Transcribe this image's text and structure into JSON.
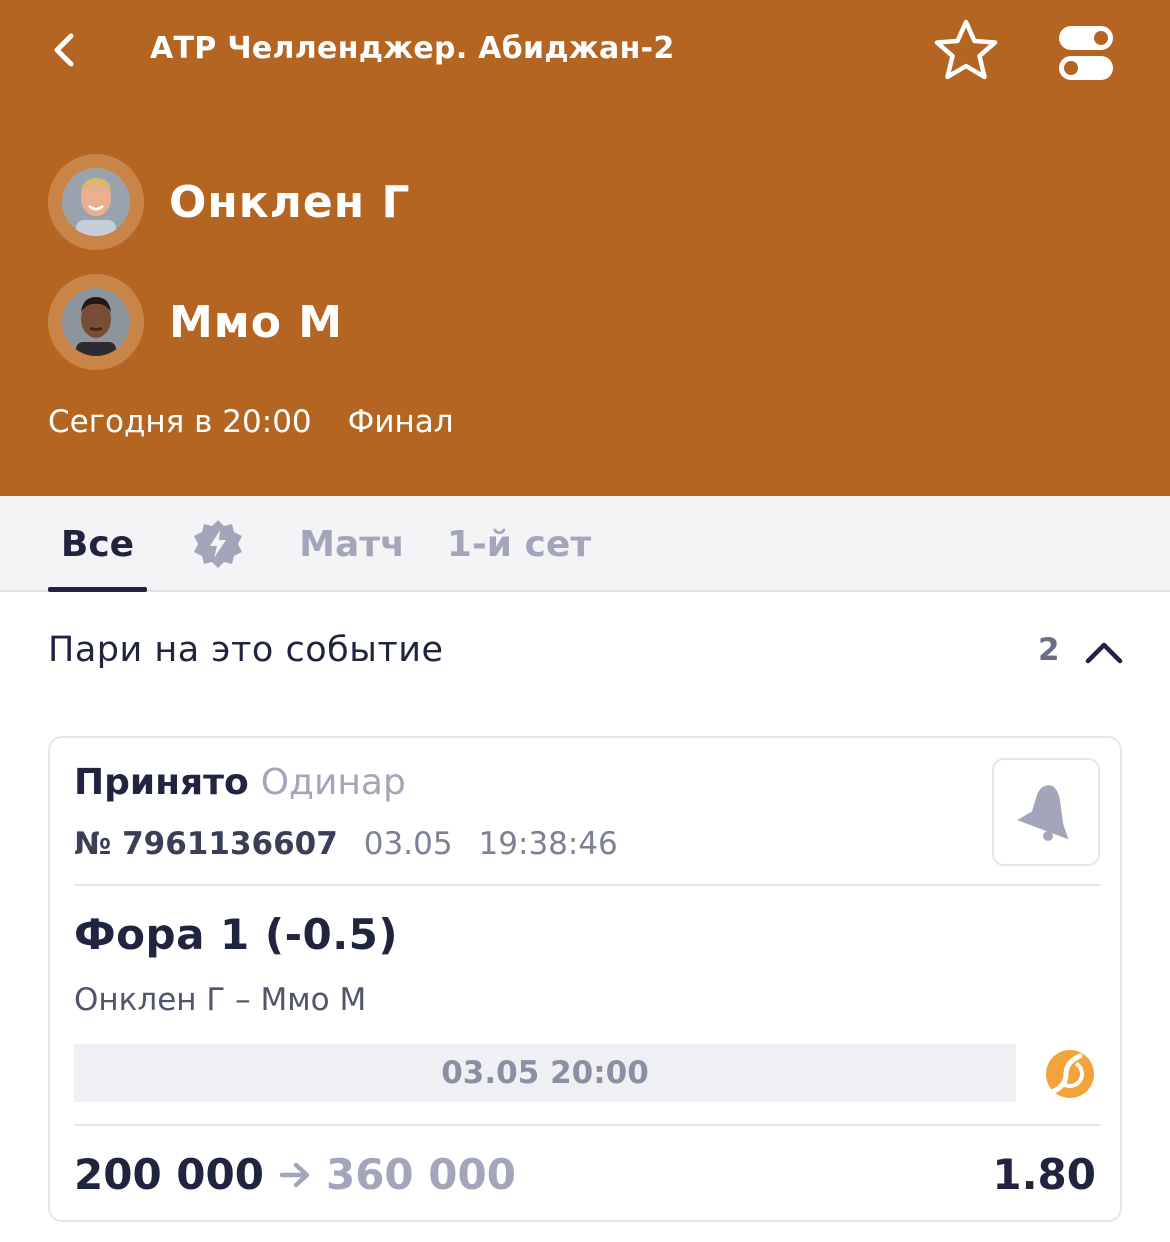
{
  "header": {
    "title": "АТР Челленджер. Абиджан-2",
    "background": "#B46522"
  },
  "players": [
    {
      "name": "Онклен Г"
    },
    {
      "name": "Ммо М"
    }
  ],
  "match": {
    "start": "Сегодня в 20:00",
    "stage": "Финал"
  },
  "tabs": [
    {
      "label": "Все",
      "active": true
    },
    {
      "icon": "lightning-badge-icon"
    },
    {
      "label": "Матч"
    },
    {
      "label": "1-й сет"
    }
  ],
  "section": {
    "title": "Пари на это событие",
    "count": "2"
  },
  "bet": {
    "status": "Принято",
    "type": "Одинар",
    "number": "№ 7961136607",
    "date": "03.05",
    "time": "19:38:46",
    "market": "Фора 1 (-0.5)",
    "event": "Онклен Г – Ммо М",
    "event_datetime": "03.05 20:00",
    "stake": "200 000",
    "payout": "360 000",
    "odds": "1.80"
  },
  "colors": {
    "accent": "#B46522",
    "text_dark": "#20243F",
    "text_muted": "#A3A6BA",
    "sport_icon": "#F2A33A"
  }
}
